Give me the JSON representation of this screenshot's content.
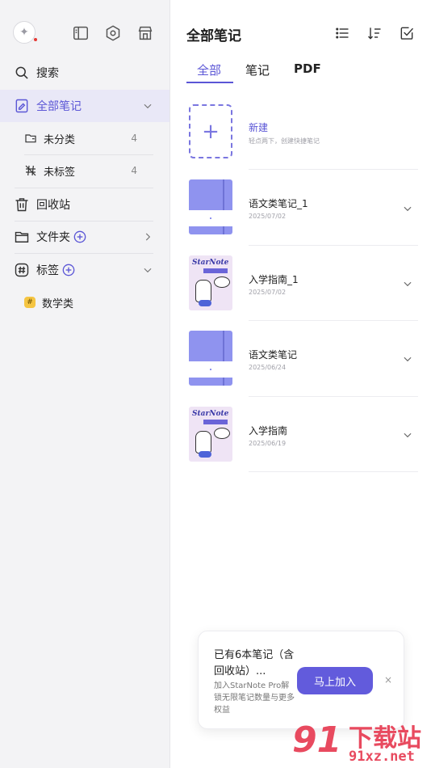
{
  "sidebar": {
    "search_label": "搜索",
    "all_notes_label": "全部笔记",
    "uncategorized_label": "未分类",
    "uncategorized_count": "4",
    "untagged_label": "未标签",
    "untagged_count": "4",
    "trash_label": "回收站",
    "folders_label": "文件夹",
    "tags_label": "标签",
    "tag_items": [
      {
        "label": "数学类",
        "color": "#f5c542"
      }
    ]
  },
  "header": {
    "title": "全部笔记",
    "icons": [
      "list-view-icon",
      "sort-icon",
      "select-icon"
    ]
  },
  "tabs": [
    {
      "label": "全部",
      "active": true
    },
    {
      "label": "笔记"
    },
    {
      "label": "PDF"
    }
  ],
  "new_note": {
    "title": "新建",
    "subtitle": "轻点两下，创建快捷笔记"
  },
  "notes": [
    {
      "name": "语文类笔记_1",
      "date": "2025/07/02",
      "cover": "blue"
    },
    {
      "name": "入学指南_1",
      "date": "2025/07/02",
      "cover": "starnote"
    },
    {
      "name": "语文类笔记",
      "date": "2025/06/24",
      "cover": "blue"
    },
    {
      "name": "入学指南",
      "date": "2025/06/19",
      "cover": "starnote"
    }
  ],
  "cover_text": "StarNote",
  "promo": {
    "title": "已有6本笔记（含回收站）...",
    "desc": "加入StarNote Pro解锁无限笔记数量与更多权益",
    "button": "马上加入",
    "close": "×"
  },
  "watermark": {
    "number": "91",
    "text": "下载站",
    "url": "91xz.net"
  },
  "colors": {
    "accent": "#5b56d6",
    "button": "#625bdc",
    "watermark": "#e84a5f"
  }
}
